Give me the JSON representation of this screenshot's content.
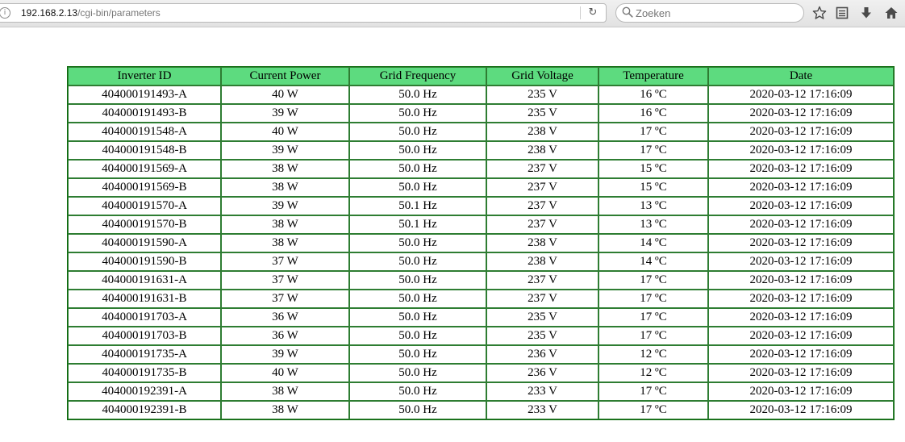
{
  "browser": {
    "url_host": "192.168.2.13",
    "url_path": "/cgi-bin/parameters",
    "search_placeholder": "Zoeken"
  },
  "table": {
    "columns": [
      "Inverter ID",
      "Current Power",
      "Grid Frequency",
      "Grid Voltage",
      "Temperature",
      "Date"
    ],
    "rows": [
      [
        "404000191493-A",
        "40 W",
        "50.0 Hz",
        "235 V",
        "16 ºC",
        "2020-03-12 17:16:09"
      ],
      [
        "404000191493-B",
        "39 W",
        "50.0 Hz",
        "235 V",
        "16 ºC",
        "2020-03-12 17:16:09"
      ],
      [
        "404000191548-A",
        "40 W",
        "50.0 Hz",
        "238 V",
        "17 ºC",
        "2020-03-12 17:16:09"
      ],
      [
        "404000191548-B",
        "39 W",
        "50.0 Hz",
        "238 V",
        "17 ºC",
        "2020-03-12 17:16:09"
      ],
      [
        "404000191569-A",
        "38 W",
        "50.0 Hz",
        "237 V",
        "15 ºC",
        "2020-03-12 17:16:09"
      ],
      [
        "404000191569-B",
        "38 W",
        "50.0 Hz",
        "237 V",
        "15 ºC",
        "2020-03-12 17:16:09"
      ],
      [
        "404000191570-A",
        "39 W",
        "50.1 Hz",
        "237 V",
        "13 ºC",
        "2020-03-12 17:16:09"
      ],
      [
        "404000191570-B",
        "38 W",
        "50.1 Hz",
        "237 V",
        "13 ºC",
        "2020-03-12 17:16:09"
      ],
      [
        "404000191590-A",
        "38 W",
        "50.0 Hz",
        "238 V",
        "14 ºC",
        "2020-03-12 17:16:09"
      ],
      [
        "404000191590-B",
        "37 W",
        "50.0 Hz",
        "238 V",
        "14 ºC",
        "2020-03-12 17:16:09"
      ],
      [
        "404000191631-A",
        "37 W",
        "50.0 Hz",
        "237 V",
        "17 ºC",
        "2020-03-12 17:16:09"
      ],
      [
        "404000191631-B",
        "37 W",
        "50.0 Hz",
        "237 V",
        "17 ºC",
        "2020-03-12 17:16:09"
      ],
      [
        "404000191703-A",
        "36 W",
        "50.0 Hz",
        "235 V",
        "17 ºC",
        "2020-03-12 17:16:09"
      ],
      [
        "404000191703-B",
        "36 W",
        "50.0 Hz",
        "235 V",
        "17 ºC",
        "2020-03-12 17:16:09"
      ],
      [
        "404000191735-A",
        "39 W",
        "50.0 Hz",
        "236 V",
        "12 ºC",
        "2020-03-12 17:16:09"
      ],
      [
        "404000191735-B",
        "40 W",
        "50.0 Hz",
        "236 V",
        "12 ºC",
        "2020-03-12 17:16:09"
      ],
      [
        "404000192391-A",
        "38 W",
        "50.0 Hz",
        "233 V",
        "17 ºC",
        "2020-03-12 17:16:09"
      ],
      [
        "404000192391-B",
        "38 W",
        "50.0 Hz",
        "233 V",
        "17 ºC",
        "2020-03-12 17:16:09"
      ]
    ]
  },
  "colors": {
    "header_bg": "#5ddb7f",
    "border": "#2e7d32"
  },
  "icons": [
    "info-icon",
    "reload-icon",
    "search-icon",
    "star-icon",
    "reading-list-icon",
    "download-icon",
    "home-icon"
  ]
}
